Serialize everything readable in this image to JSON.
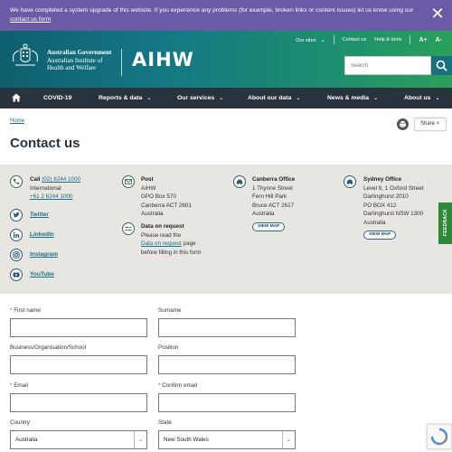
{
  "alert": {
    "text_before": "We have completed a system upgrade of this website. If you experience any problems (for example, broken links or content issues) let us know using our ",
    "link": "contact us form",
    "text_after": ".",
    "close_icon": "close-icon"
  },
  "header": {
    "gov_line1": "Australian Government",
    "gov_line2": "Australian Institute of",
    "gov_line3": "Health and Welfare",
    "logo_text": "AIHW",
    "top_links": {
      "our_sites": "Our sites",
      "contact_us": "Contact us",
      "help_tools": "Help & tools",
      "text_larger": "A+",
      "text_smaller": "A-"
    },
    "search_placeholder": "Search"
  },
  "nav": {
    "items": [
      {
        "label": "COVID-19"
      },
      {
        "label": "Reports & data"
      },
      {
        "label": "Our services"
      },
      {
        "label": "About our data"
      },
      {
        "label": "News & media"
      },
      {
        "label": "About us"
      }
    ]
  },
  "page": {
    "breadcrumb": "Home",
    "title": "Contact us",
    "share": "Share"
  },
  "contact": {
    "call": {
      "label": "Call",
      "number": "(02) 6244 1000",
      "intl_label": "International",
      "intl_number": "+61 2 6244 1000"
    },
    "social": [
      "Twitter",
      "LinkedIn",
      "Instagram",
      "YouTube"
    ],
    "post": {
      "label": "Post",
      "lines": [
        "AIHW",
        "GPO Box 570",
        "Canberra ACT 2601",
        "Australia"
      ]
    },
    "data_request": {
      "label": "Data on request",
      "line1": "Please read the",
      "link": "Data on request",
      "link_after": " page",
      "line3": "before filling in this form"
    },
    "canberra": {
      "label": "Canberra Office",
      "lines": [
        "1 Thynne Street",
        "Fern Hill Park",
        "Bruce ACT 2617",
        "Australia"
      ],
      "map": "VIEW MAP"
    },
    "sydney": {
      "label": "Sydney Office",
      "lines": [
        "Level 9, 1 Oxford Street",
        "Darlinghurst 2010",
        "PO BOX 412",
        "Darlinghurst NSW 1300",
        "Australia"
      ],
      "map": "VIEW MAP"
    }
  },
  "feedback": "FEEDBACK",
  "form": {
    "first_name": "First name",
    "surname": "Surname",
    "business": "Business/Organisation/School",
    "position": "Position",
    "email": "Email",
    "confirm_email": "Confirm email",
    "country_label": "Country",
    "country_value": "Australia",
    "state_label": "State",
    "state_value": "New South Wales"
  },
  "colors": {
    "alert": "#6b5aa6",
    "nav": "#29333d",
    "link": "#1a6f8c",
    "panel": "#e8e6e1",
    "feedback": "#2e8a3a"
  }
}
